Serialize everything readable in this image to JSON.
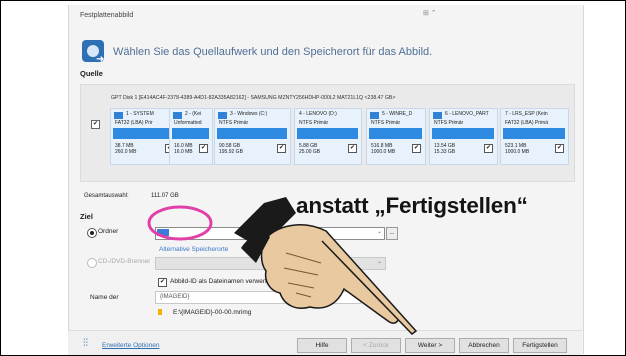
{
  "window": {
    "title": "Festplattenabbild",
    "controls": "⊞ ⌃"
  },
  "heading": "Wählen Sie das Quellaufwerk und den Speicherort für das Abbild.",
  "source": {
    "label": "Quelle",
    "disk_info": "GPT Disk 1 [E414AC4F-2378-4389-A4D1-82A335A82162] - SAMSUNG MZNTY256HDHP-000L2 MAT21L1Q  <238.47 GB>",
    "disk_checked": "✔",
    "partitions": [
      {
        "name": "1 - SYSTEM",
        "fs": "FAT32 (LBA) Prir",
        "used": "38.7 MB",
        "total": "260.0 MB"
      },
      {
        "name": "2 - (Kei",
        "fs": "Unformatted",
        "used": "16.0 MB",
        "total": "16.0 MB"
      },
      {
        "name": "3 - Windows (C:)",
        "fs": "NTFS Primär",
        "used": "90.58 GB",
        "total": "195.92 GB"
      },
      {
        "name": "4 - LENOVO (D:)",
        "fs": "NTFS Primär",
        "used": "5.88 GB",
        "total": "25.00 GB"
      },
      {
        "name": "5 - WINRE_D",
        "fs": "NTFS Primär",
        "used": "516.8 MB",
        "total": "1000.0 MB"
      },
      {
        "name": "6 - LENOVO_PART",
        "fs": "NTFS Primär",
        "used": "13.54 GB",
        "total": "15.33 GB"
      },
      {
        "name": "7 - LRS_ESP (Kein",
        "fs": "FAT32 (LBA) Primä",
        "used": "523.1 MB",
        "total": "1000.0 MB"
      }
    ],
    "check": "✔"
  },
  "total_selection": {
    "label": "Gesamtauswahl:",
    "value": "111.07 GB"
  },
  "destination": {
    "label": "Ziel",
    "folder_label": "Ordner",
    "folder_dropdown": "⌄",
    "browse": "...",
    "alt_link": "Alternative Speicherorte",
    "cd_label": "CD-/DVD-Brenner",
    "cd_dropdown": "⌄",
    "image_id_checkbox": "Abbild-ID als Dateinamen verwenden",
    "image_id_check": "✔",
    "name_label": "Name der",
    "name_value": "{IMAGEID}",
    "path": "E:\\{IMAGEID}-00-00.mrimg"
  },
  "footer": {
    "options_icon": "sliders-icon",
    "options_link": "Erweiterte Optionen",
    "buttons": {
      "help": "Hilfe",
      "back": "< Zurück",
      "next": "Weiter >",
      "cancel": "Abbrechen",
      "finish": "Fertigstellen"
    }
  },
  "annotation": {
    "text": "anstatt „Fertigstellen“",
    "marker_color": "#e040a8"
  }
}
